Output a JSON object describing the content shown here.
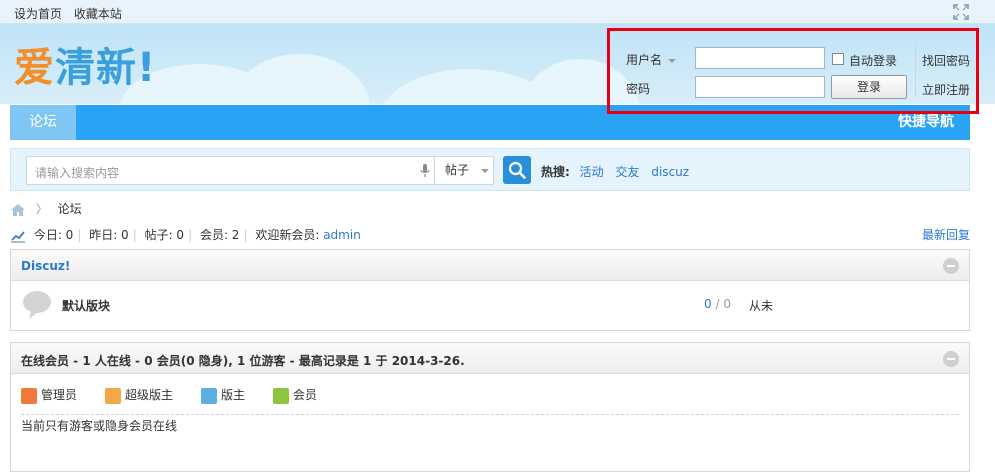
{
  "topbar": {
    "set_homepage": "设为首页",
    "bookmark": "收藏本站"
  },
  "logo": {
    "part1": "爱",
    "part2": "清新",
    "part3": "!"
  },
  "login": {
    "username_label": "用户名",
    "password_label": "密码",
    "auto_login": "自动登录",
    "login_button": "登录",
    "forgot_password": "找回密码",
    "register": "立即注册"
  },
  "nav": {
    "tab_forum": "论坛",
    "quick_nav": "快捷导航"
  },
  "search": {
    "placeholder": "请输入搜索内容",
    "type": "帖子",
    "hot_label": "热搜:",
    "hot_words": [
      "活动",
      "交友",
      "discuz"
    ]
  },
  "breadcrumb": {
    "current": "论坛"
  },
  "stats": {
    "today": "今日: 0",
    "yesterday": "昨日: 0",
    "posts": "帖子: 0",
    "members": "会员: 2",
    "welcome": "欢迎新会员:",
    "new_member": "admin",
    "latest_reply": "最新回复"
  },
  "forum_group": {
    "title": "Discuz!",
    "forums": [
      {
        "name": "默认版块",
        "threads": "0",
        "sep": " / ",
        "posts": "0",
        "last": "从未"
      }
    ]
  },
  "online": {
    "title": "在线会员 - 1 人在线 - 0 会员(0 隐身), 1 位游客 - 最高记录是 1 于 2014-3-26.",
    "legend": [
      "管理员",
      "超级版主",
      "版主",
      "会员"
    ],
    "note": "当前只有游客或隐身会员在线"
  },
  "colors": {
    "nav_bg": "#2aa3f5",
    "highlight_border": "#e60012",
    "link": "#2b7acd",
    "logo_orange": "#f28e2b",
    "logo_blue": "#3aa0dc"
  }
}
